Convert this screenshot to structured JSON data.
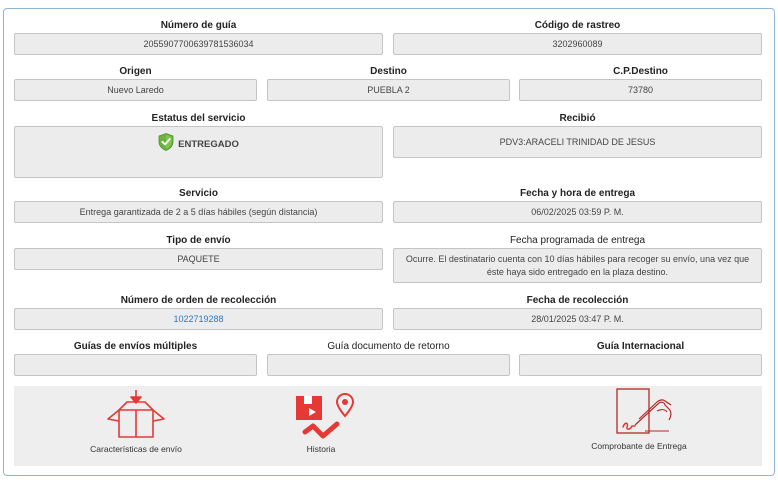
{
  "fields": {
    "guia": {
      "label": "Número de guía",
      "value": "2055907700639781536034"
    },
    "rastreo": {
      "label": "Código de rastreo",
      "value": "3202960089"
    },
    "origen": {
      "label": "Origen",
      "value": "Nuevo Laredo"
    },
    "destino": {
      "label": "Destino",
      "value": "PUEBLA 2"
    },
    "cp_destino": {
      "label": "C.P.Destino",
      "value": "73780"
    },
    "estatus": {
      "label": "Estatus del servicio",
      "value": "ENTREGADO"
    },
    "recibio": {
      "label": "Recibió",
      "value": "PDV3:ARACELI TRINIDAD DE JESUS"
    },
    "servicio": {
      "label": "Servicio",
      "value": "Entrega garantizada de 2 a 5 días hábiles (según distancia)"
    },
    "fecha_entrega": {
      "label": "Fecha y hora de entrega",
      "value": "06/02/2025 03:59 P. M."
    },
    "tipo_envio": {
      "label": "Tipo de envío",
      "value": "PAQUETE"
    },
    "fecha_programada": {
      "label": "Fecha programada de entrega",
      "value": "Ocurre. El destinatario cuenta con 10 días hábiles para recoger su envío, una vez que éste haya sido entregado en la plaza destino."
    },
    "orden_recoleccion": {
      "label": "Número de orden de recolección",
      "value": "1022719288"
    },
    "fecha_recoleccion": {
      "label": "Fecha de recolección",
      "value": "28/01/2025 03:47 P. M."
    },
    "guias_multiples": {
      "label": "Guías de envíos múltiples",
      "value": ""
    },
    "guia_retorno": {
      "label": "Guía documento de retorno",
      "value": ""
    },
    "guia_internacional": {
      "label": "Guía Internacional",
      "value": ""
    }
  },
  "actions": {
    "caracteristicas": "Características de envío",
    "historia": "Historia",
    "comprobante": "Comprobante de Entrega"
  },
  "colors": {
    "accent": "#e53935",
    "link": "#2a7bc9",
    "status_ok": "#6cb33f"
  },
  "icons": {
    "status": "shield-check-icon",
    "caracteristicas": "open-box-icon",
    "historia": "route-history-icon",
    "comprobante": "signature-document-icon"
  }
}
